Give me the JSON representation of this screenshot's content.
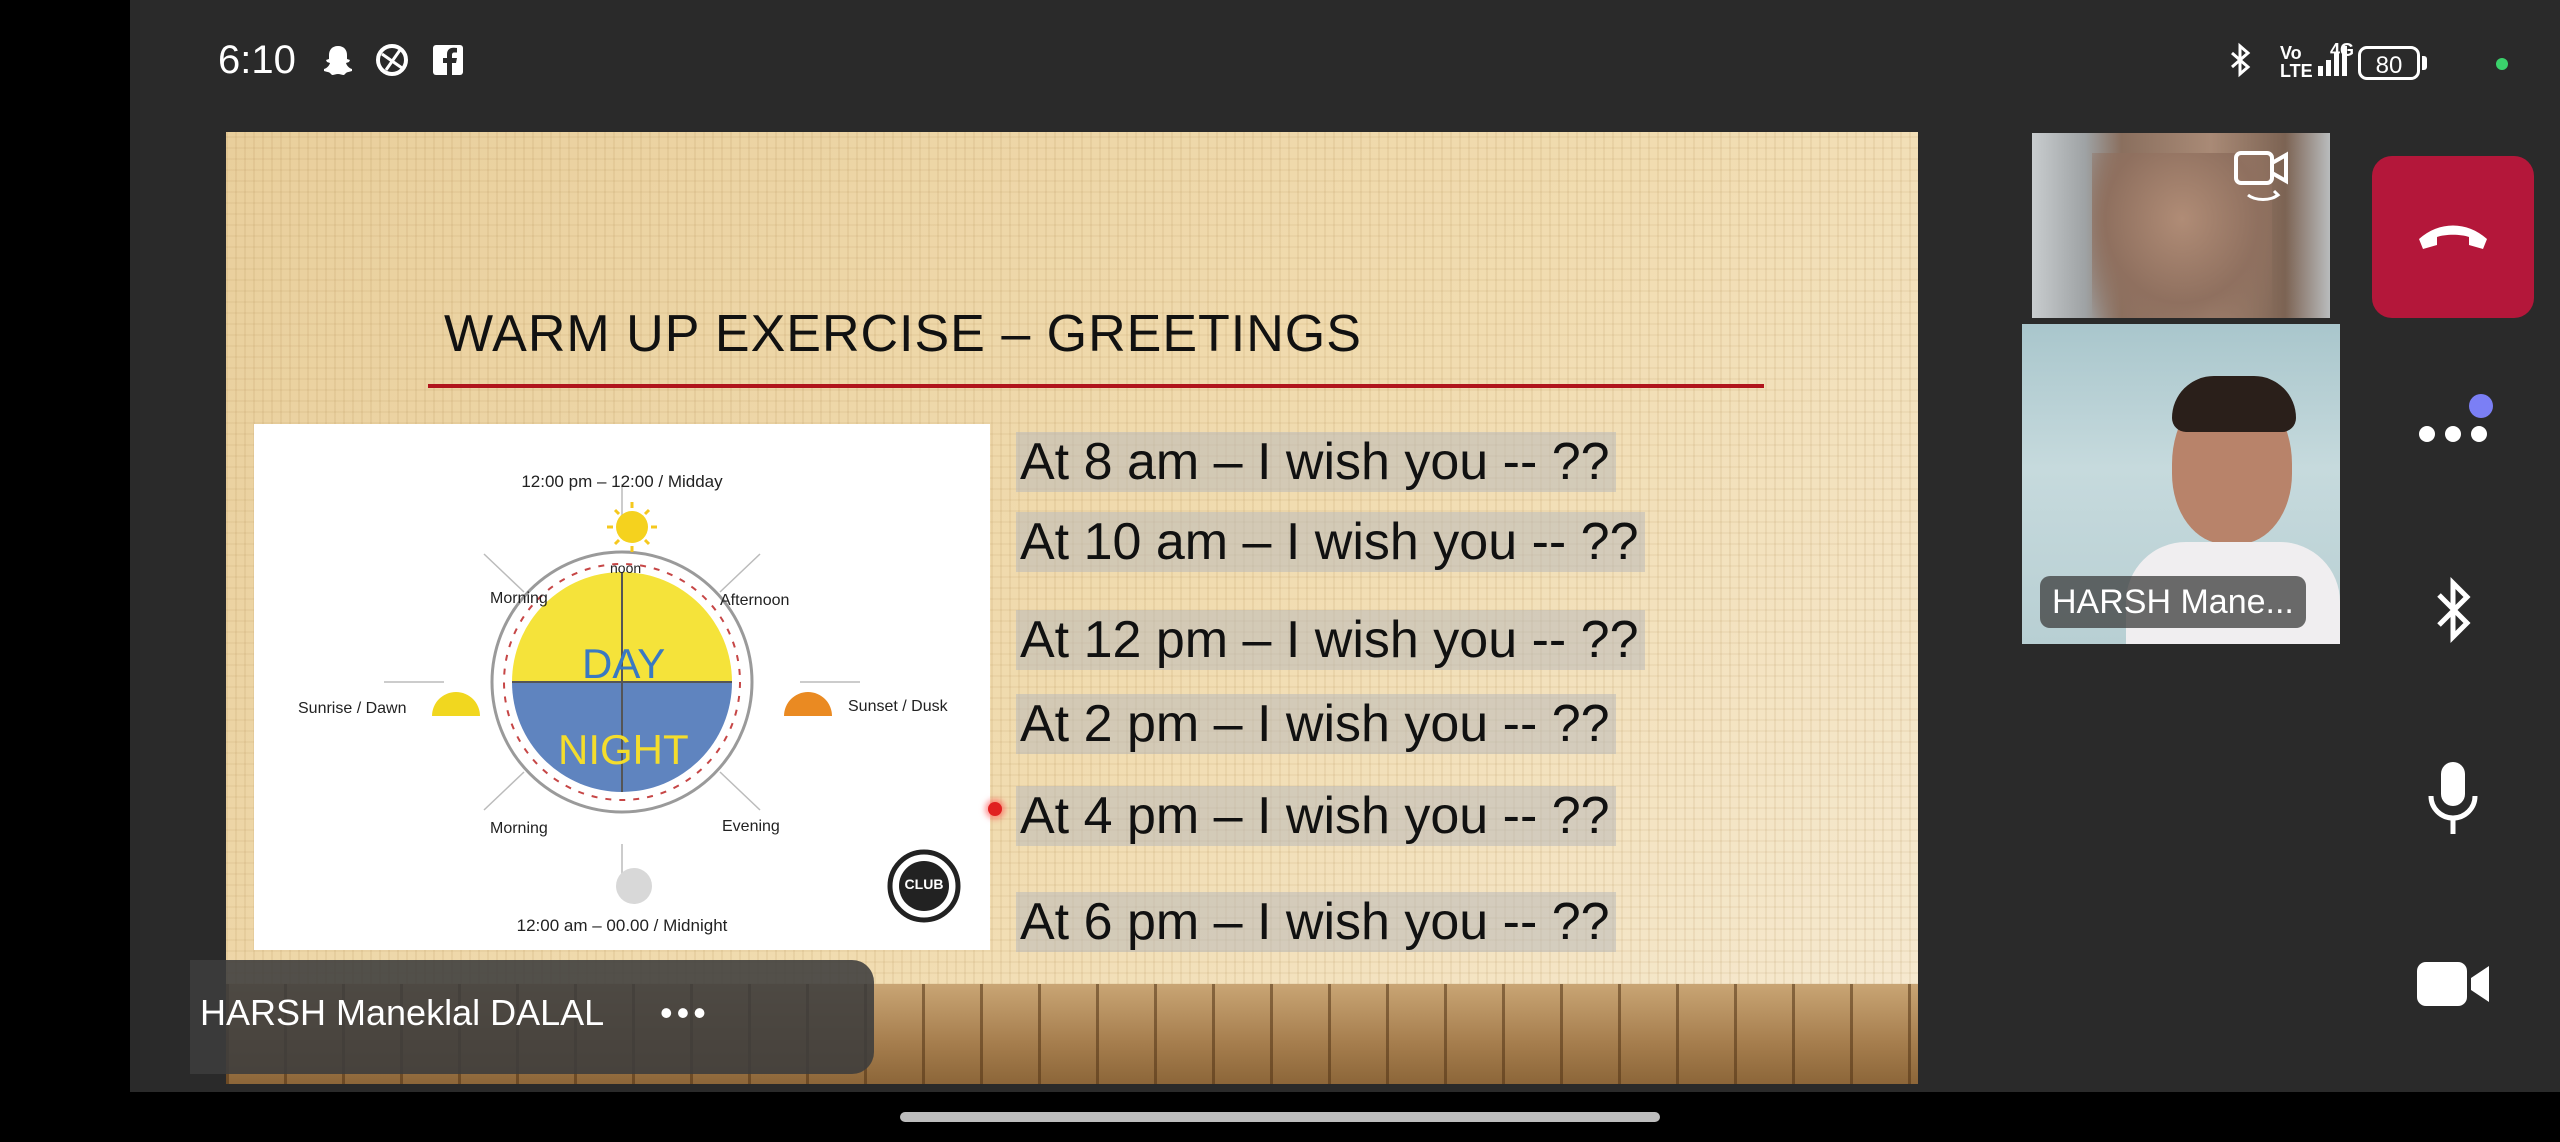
{
  "status_bar": {
    "time": "6:10",
    "network_text": "Vo LTE",
    "signal_text": "4G",
    "battery": "80"
  },
  "slide": {
    "title": "WARM UP EXERCISE – GREETINGS",
    "diagram": {
      "top_label": "12:00 pm – 12:00 / Midday",
      "bottom_label": "12:00 am – 00.00 / Midnight",
      "noon": "noon",
      "day": "DAY",
      "night": "NIGHT",
      "morning_top": "Morning",
      "afternoon": "Afternoon",
      "sunrise": "Sunrise / Dawn",
      "sunset": "Sunset / Dusk",
      "morning_bottom": "Morning",
      "evening": "Evening",
      "logo": "CLUB"
    },
    "greetings": [
      "At 8 am – I wish you -- ??",
      "At 10 am – I wish you -- ??",
      "At 12 pm – I wish you -- ??",
      "At 2 pm – I wish you -- ??",
      "At 4 pm – I wish you -- ??",
      "At 6 pm – I wish you -- ??"
    ]
  },
  "presenter_bar": {
    "name": "HARSH Maneklal DALAL",
    "more": "•••"
  },
  "participant_tile": {
    "name": "HARSH Mane..."
  },
  "colors": {
    "end_call": "#b4173a",
    "accent_dot": "#7b7ff5",
    "title_rule": "#b0141c"
  },
  "icons": [
    "snapchat-icon",
    "vpn-icon",
    "facebook-icon",
    "bluetooth-icon",
    "switch-camera-icon",
    "end-call-icon",
    "more-icon",
    "mic-icon",
    "video-icon"
  ]
}
